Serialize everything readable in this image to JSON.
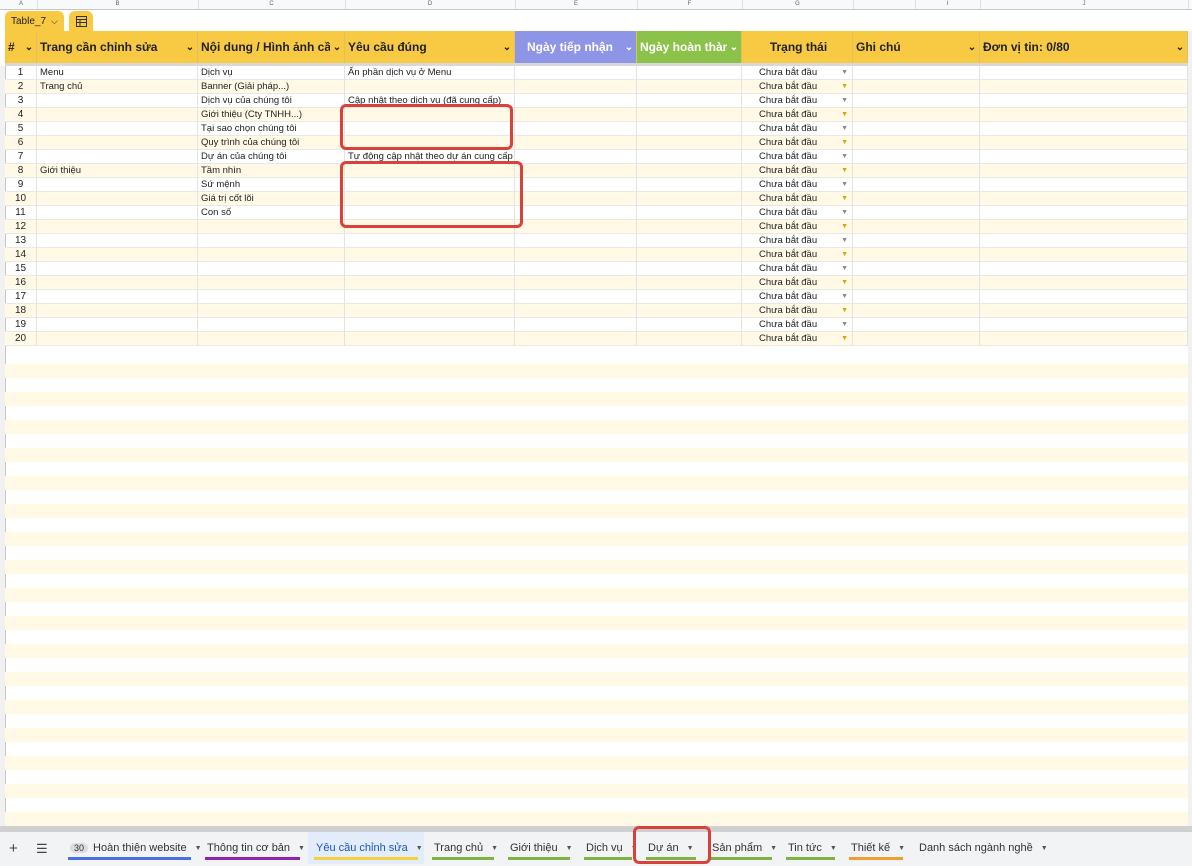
{
  "column_letters": [
    "A",
    "B",
    "C",
    "D",
    "E",
    "F",
    "G",
    "",
    "I",
    "J"
  ],
  "table_name": "Table_7",
  "headers": [
    {
      "label": "#",
      "bg": "#f8c943",
      "color": "#222"
    },
    {
      "label": "Trang cần chỉnh sửa",
      "bg": "#f8c943",
      "color": "#222"
    },
    {
      "label": "Nội dung / Hình ảnh cần chỉ",
      "bg": "#f8c943",
      "color": "#222"
    },
    {
      "label": "Yêu cầu đúng",
      "bg": "#f8c943",
      "color": "#222"
    },
    {
      "label": "Ngày tiếp nhận",
      "bg": "#8e95e6",
      "color": "#ffffff"
    },
    {
      "label": "Ngày hoàn thành",
      "bg": "#8bc34a",
      "color": "#ffffff"
    },
    {
      "label": "Trạng thái",
      "bg": "#f8c943",
      "color": "#222"
    },
    {
      "label": "Ghi chú",
      "bg": "#f8c943",
      "color": "#222"
    },
    {
      "label": "Đơn vị tin: 0/80",
      "bg": "#f8c943",
      "color": "#222"
    }
  ],
  "status_default": "Chưa bắt đầu",
  "rows": [
    {
      "n": "1",
      "page": "Menu",
      "content": "Dịch vụ",
      "req": "Ẩn phần dịch vụ ở Menu"
    },
    {
      "n": "2",
      "page": "Trang chủ",
      "content": "Banner (Giải pháp...)",
      "req": ""
    },
    {
      "n": "3",
      "page": "",
      "content": "Dịch vụ của chúng tôi",
      "req": "Cập nhật theo dịch vụ (đã cung cấp)"
    },
    {
      "n": "4",
      "page": "",
      "content": "Giới thiệu (Cty TNHH...)",
      "req": ""
    },
    {
      "n": "5",
      "page": "",
      "content": "Tại sao chọn chúng tôi",
      "req": ""
    },
    {
      "n": "6",
      "page": "",
      "content": "Quy trình của chúng tôi",
      "req": ""
    },
    {
      "n": "7",
      "page": "",
      "content": "Dự án của chúng tôi",
      "req": "Tự động cập nhật theo dự án cung cấp"
    },
    {
      "n": "8",
      "page": "Giới thiệu",
      "content": "Tầm nhìn",
      "req": ""
    },
    {
      "n": "9",
      "page": "",
      "content": "Sứ mệnh",
      "req": ""
    },
    {
      "n": "10",
      "page": "",
      "content": "Giá trị cốt lõi",
      "req": ""
    },
    {
      "n": "11",
      "page": "",
      "content": "Con số",
      "req": ""
    },
    {
      "n": "12",
      "page": "",
      "content": "",
      "req": ""
    },
    {
      "n": "13",
      "page": "",
      "content": "",
      "req": ""
    },
    {
      "n": "14",
      "page": "",
      "content": "",
      "req": ""
    },
    {
      "n": "15",
      "page": "",
      "content": "",
      "req": ""
    },
    {
      "n": "16",
      "page": "",
      "content": "",
      "req": ""
    },
    {
      "n": "17",
      "page": "",
      "content": "",
      "req": ""
    },
    {
      "n": "18",
      "page": "",
      "content": "",
      "req": ""
    },
    {
      "n": "19",
      "page": "",
      "content": "",
      "req": ""
    },
    {
      "n": "20",
      "page": "",
      "content": "",
      "req": ""
    }
  ],
  "sheet_tabs": [
    {
      "label": "Hoàn thiện website",
      "badge": "30",
      "color": "#4a6fe0"
    },
    {
      "label": "Thông tin cơ bản",
      "badge": "",
      "color": "#8e24aa"
    },
    {
      "label": "Yêu cầu chỉnh sửa",
      "badge": "",
      "color": "#f4d03f",
      "active": true
    },
    {
      "label": "Trang chủ",
      "badge": "",
      "color": "#7cb342"
    },
    {
      "label": "Giới thiệu",
      "badge": "",
      "color": "#7cb342"
    },
    {
      "label": "Dịch vụ",
      "badge": "",
      "color": "#7cb342"
    },
    {
      "label": "Dự án",
      "badge": "",
      "color": "#7cb342"
    },
    {
      "label": "Sản phẩm",
      "badge": "",
      "color": "#7cb342"
    },
    {
      "label": "Tin tức",
      "badge": "",
      "color": "#7cb342"
    },
    {
      "label": "Thiết kế",
      "badge": "",
      "color": "#f0a030"
    },
    {
      "label": "Danh sách ngành nghề",
      "badge": "",
      "color": ""
    }
  ]
}
